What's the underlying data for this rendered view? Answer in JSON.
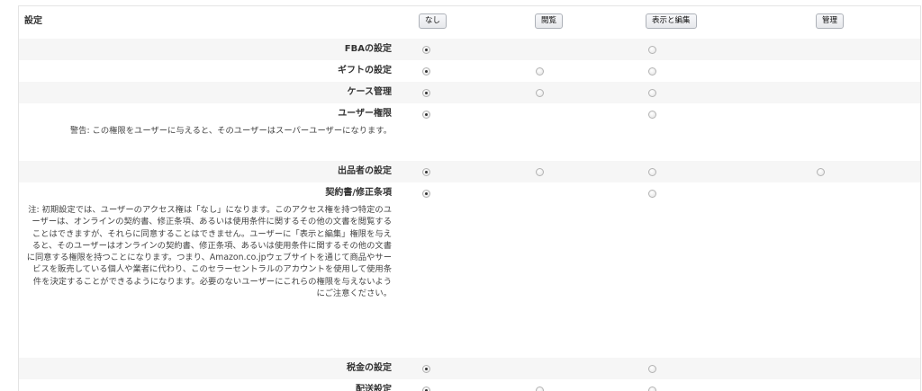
{
  "header": {
    "title": "設定",
    "options": [
      "なし",
      "閲覧",
      "表示と編集",
      "管理"
    ]
  },
  "rows": [
    {
      "title": "FBAの設定",
      "note": "",
      "radios": [
        "checked",
        "none",
        "unchecked",
        "none"
      ]
    },
    {
      "title": "ギフトの設定",
      "note": "",
      "radios": [
        "checked",
        "unchecked",
        "unchecked",
        "none"
      ]
    },
    {
      "title": "ケース管理",
      "note": "",
      "radios": [
        "checked",
        "unchecked",
        "unchecked",
        "none"
      ]
    },
    {
      "title": "ユーザー権限",
      "note": "警告: この権限をユーザーに与えると、そのユーザーはスーパーユーザーになります。",
      "radios": [
        "checked",
        "none",
        "unchecked",
        "none"
      ]
    },
    {
      "title": "出品者の設定",
      "note": "",
      "radios": [
        "checked",
        "unchecked",
        "unchecked",
        "unchecked"
      ]
    },
    {
      "title": "契約書/修正条項",
      "note": "注: 初期設定では、ユーザーのアクセス権は「なし」になります。このアクセス権を持つ特定のユーザーは、オンラインの契約書、修正条項、あるいは使用条件に関するその他の文書を閲覧することはできますが、それらに同意することはできません。ユーザーに「表示と編集」権限を与えると、そのユーザーはオンラインの契約書、修正条項、あるいは使用条件に関するその他の文書に同意する権限を持つことになります。つまり、Amazon.co.jpウェブサイトを通じて商品やサービスを販売している個人や業者に代わり、このセラーセントラルのアカウントを使用して使用条件を決定することができるようになります。必要のないユーザーにこれらの権限を与えないようにご注意ください。",
      "radios": [
        "checked",
        "none",
        "unchecked",
        "none"
      ]
    },
    {
      "title": "税金の設定",
      "note": "",
      "radios": [
        "checked",
        "none",
        "unchecked",
        "none"
      ]
    },
    {
      "title": "配送設定",
      "note": "",
      "radios": [
        "checked",
        "unchecked",
        "unchecked",
        "none"
      ]
    }
  ]
}
